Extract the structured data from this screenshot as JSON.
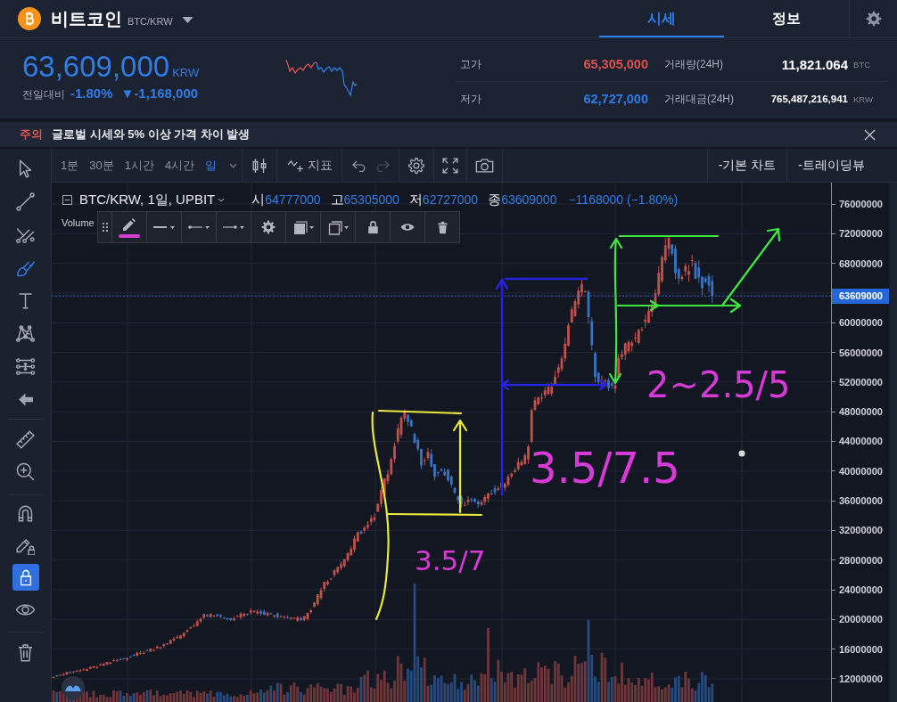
{
  "header": {
    "coin_name": "비트코인",
    "pair": "BTC/KRW",
    "tabs": [
      {
        "label": "시세",
        "selected": true
      },
      {
        "label": "정보",
        "selected": false
      }
    ]
  },
  "ticker": {
    "price": "63,609,000",
    "currency": "KRW",
    "rising": false,
    "change_label": "전일대비",
    "change_rate": "-1.80%",
    "change_amount": "▼-1,168,000",
    "rows": [
      {
        "label": "고가",
        "value": "65,305,000",
        "rising": true,
        "volume_label": "거래량(24H)",
        "volume_value": "11,821.064",
        "volume_unit": "BTC"
      },
      {
        "label": "저가",
        "value": "62,727,000",
        "rising": false,
        "volume_label": "거래대금(24H)",
        "volume_value": "765,487,216,941",
        "volume_unit": "KRW"
      }
    ]
  },
  "notice": {
    "tag": "주의",
    "message": "글로벌 시세와 5% 이상 가격 차이 발생"
  },
  "toolbar": {
    "intervals": [
      {
        "label": "1분",
        "selected": false
      },
      {
        "label": "30분",
        "selected": false
      },
      {
        "label": "1시간",
        "selected": false
      },
      {
        "label": "4시간",
        "selected": false
      },
      {
        "label": "일",
        "selected": true
      }
    ],
    "indicator_label": "지표",
    "history": [
      {
        "disabled": false
      },
      {
        "disabled": true
      }
    ],
    "chart_types": [
      "-기본 차트",
      "-트레이딩뷰"
    ]
  },
  "left_toolbar": {
    "tools": [
      {
        "selected": false
      },
      {
        "selected": false
      },
      {
        "selected": false
      },
      {
        "selected": true
      },
      {
        "selected": false
      },
      {
        "selected": false
      },
      {
        "selected": false
      }
    ],
    "toggles": [
      {
        "on": false
      },
      {
        "on": false
      },
      {
        "on": true
      },
      {
        "on": false
      }
    ]
  },
  "chart": {
    "symbol": "BTC/KRW, 1일, UPBIT",
    "ohlc": [
      {
        "label": "시",
        "value": "64777000"
      },
      {
        "label": "고",
        "value": "65305000"
      },
      {
        "label": "저",
        "value": "62727000"
      },
      {
        "label": "종",
        "value": "63609000"
      }
    ],
    "change": "−1168000 (−1.80%)",
    "volume_label": "Volume",
    "price_ticks": [
      "76000000",
      "72000000",
      "68000000",
      "60000000",
      "56000000",
      "52000000",
      "48000000",
      "44000000",
      "40000000",
      "36000000",
      "32000000",
      "28000000",
      "24000000",
      "20000000",
      "16000000",
      "12000000"
    ],
    "last_price": "63609000",
    "notes": [
      "3.5/7",
      "3.5/7.5",
      "2~2.5/5"
    ]
  },
  "drawing_toolbar": {
    "color": "#d63cd6"
  }
}
